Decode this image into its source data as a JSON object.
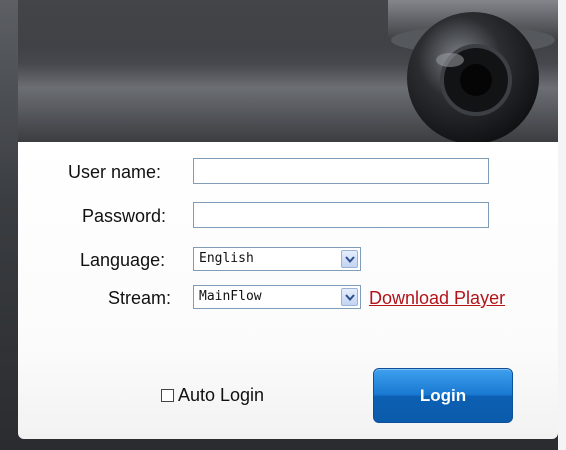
{
  "form": {
    "username": {
      "label": "User name:",
      "value": "",
      "placeholder": ""
    },
    "password": {
      "label": "Password:",
      "value": "",
      "placeholder": ""
    },
    "language": {
      "label": "Language:",
      "selected": "English"
    },
    "stream": {
      "label": "Stream:",
      "selected": "MainFlow"
    },
    "download_link": "Download Player",
    "auto_login": {
      "label": "Auto Login",
      "checked": false
    },
    "login_button": "Login"
  },
  "colors": {
    "link": "#b2141a",
    "button": "#1a79d1",
    "input_border": "#7f9db9"
  },
  "icons": {
    "dropdown": "chevron-down-icon",
    "banner": "dome-camera-icon"
  }
}
